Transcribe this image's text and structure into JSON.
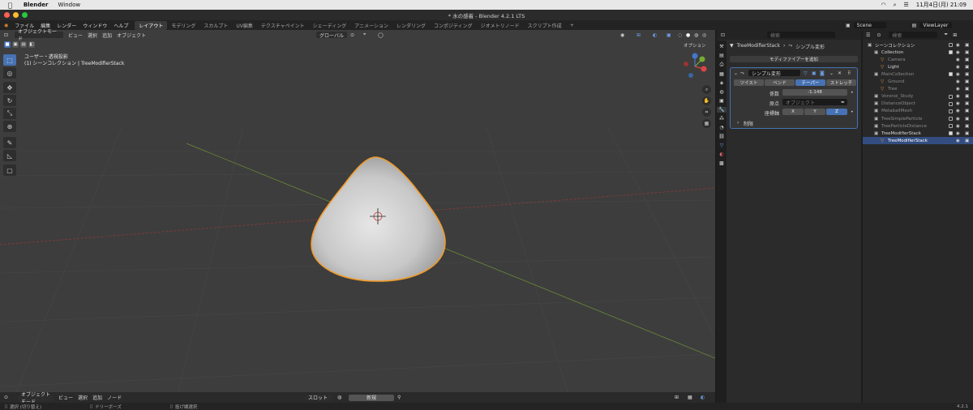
{
  "macbar": {
    "app": "Blender",
    "menu_window": "Window",
    "datetime": "11月4日(月) 21:09"
  },
  "window": {
    "title": "* 水の感着 - Blender 4.2.1 LTS"
  },
  "topbar": {
    "menus": [
      "ファイル",
      "編集",
      "レンダー",
      "ウィンドウ",
      "ヘルプ"
    ],
    "workspaces": [
      "レイアウト",
      "モデリング",
      "スカルプト",
      "UV編集",
      "テクスチャペイント",
      "シェーディング",
      "アニメーション",
      "レンダリング",
      "コンポジティング",
      "ジオメトリノード",
      "スクリプト作成"
    ],
    "active_workspace": "レイアウト",
    "add_tab": "+",
    "scene": "Scene",
    "view_layer": "ViewLayer"
  },
  "viewport": {
    "mode": "オブジェクトモード",
    "menus": [
      "ビュー",
      "選択",
      "追加",
      "オブジェクト"
    ],
    "transform_orientation": "グローバル",
    "overlay_text1": "ユーザー・透視投影",
    "overlay_text2": "(1) シーンコレクション | TreeModifierStack",
    "options": "オプション",
    "gizmo": {
      "x": "X",
      "y": "Y",
      "z": "Z"
    }
  },
  "timeline": {
    "mode": "オブジェクトモード",
    "menus": [
      "ビュー",
      "選択",
      "追加",
      "ノード"
    ],
    "slot": "スロット",
    "new": "新規"
  },
  "status": {
    "select": "選択 (切り替え)",
    "drag": "ドリーボーズ",
    "lasso": "投げ縄選択",
    "version": "4.2.1"
  },
  "properties": {
    "search_placeholder": "検索",
    "breadcrumb_object": "TreeModifierStack",
    "breadcrumb_modifier": "シンプル変形",
    "add_modifier": "モディファイアーを追加",
    "modifier_name": "シンプル変形",
    "modes": [
      "ツイスト",
      "ベンド",
      "テーパー",
      "ストレッチ"
    ],
    "active_mode": "テーパー",
    "factor_label": "係数",
    "factor_value": "-1.148",
    "origin_label": "原点",
    "origin_placeholder": "オブジェクト",
    "axis_label": "座標軸",
    "axes": [
      "X",
      "Y",
      "Z"
    ],
    "active_axis": "Z",
    "restrictions": "制限"
  },
  "outliner": {
    "search_placeholder": "検索",
    "rows": [
      {
        "label": "シーンコレクション",
        "indent": 0,
        "check": false,
        "dim": false,
        "selected": false
      },
      {
        "label": "Collection",
        "indent": 1,
        "check": true,
        "dim": false,
        "selected": false
      },
      {
        "label": "Camera",
        "indent": 2,
        "check": false,
        "dim": true,
        "selected": false
      },
      {
        "label": "Light",
        "indent": 2,
        "check": false,
        "dim": false,
        "selected": false
      },
      {
        "label": "MainCollection",
        "indent": 1,
        "check": true,
        "dim": true,
        "selected": false
      },
      {
        "label": "Ground",
        "indent": 2,
        "check": false,
        "dim": true,
        "selected": false
      },
      {
        "label": "Tree",
        "indent": 2,
        "check": false,
        "dim": true,
        "selected": false
      },
      {
        "label": "Voronoi_Study",
        "indent": 1,
        "check": false,
        "dim": true,
        "selected": false
      },
      {
        "label": "DistanceObject",
        "indent": 1,
        "check": false,
        "dim": true,
        "selected": false
      },
      {
        "label": "MetaballMesh",
        "indent": 1,
        "check": false,
        "dim": true,
        "selected": false
      },
      {
        "label": "TreeSimpleParticle",
        "indent": 1,
        "check": false,
        "dim": true,
        "selected": false
      },
      {
        "label": "TreeParticleDistance",
        "indent": 1,
        "check": false,
        "dim": true,
        "selected": false
      },
      {
        "label": "TreeModifierStack",
        "indent": 1,
        "check": true,
        "dim": false,
        "selected": false
      },
      {
        "label": "TreeModifierStack",
        "indent": 2,
        "check": false,
        "dim": false,
        "selected": true
      }
    ]
  },
  "colors": {
    "accent": "#4772b3",
    "selection_outline": "#f29c2b",
    "viewport_bg": "#3d3d3d"
  }
}
